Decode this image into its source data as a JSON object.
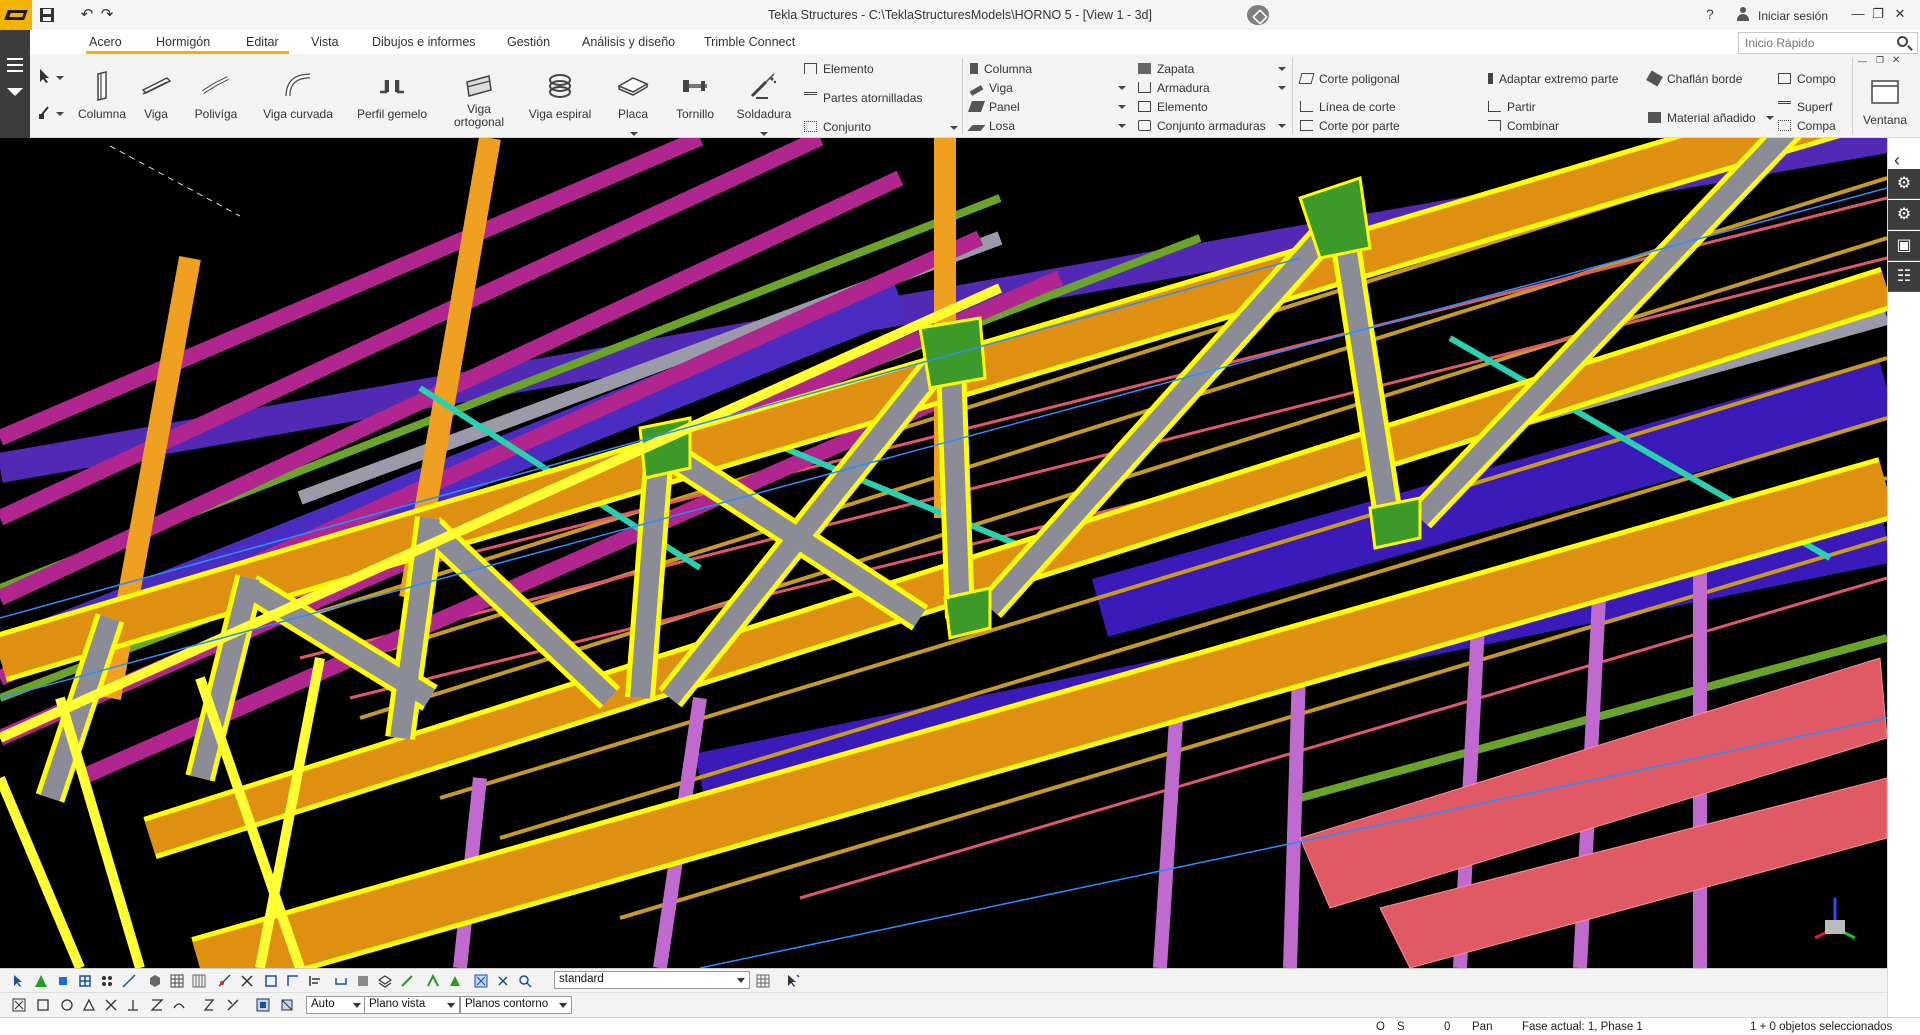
{
  "titlebar": {
    "title": "Tekla Structures - C:\\TeklaStructuresModels\\HORNO 5  - [View 1 - 3d]",
    "help": "?",
    "sign_in": "Iniciar sesión",
    "quick_access": [
      "save-icon",
      "undo-icon",
      "redo-icon"
    ]
  },
  "tabs": [
    "Acero",
    "Hormigón",
    "Editar",
    "Vista",
    "Dibujos e informes",
    "Gestión",
    "Análisis y diseño",
    "Trimble Connect"
  ],
  "active_tab": "Acero",
  "quick_search": {
    "placeholder": "Inicio Rápido"
  },
  "ribbon": {
    "steel_tools": [
      {
        "label": "Columna",
        "icon": "column-icon"
      },
      {
        "label": "Viga",
        "icon": "beam-icon"
      },
      {
        "label": "Polivíga",
        "icon": "polybeam-icon"
      },
      {
        "label": "Viga curvada",
        "icon": "curved-beam-icon"
      },
      {
        "label": "Perfil gemelo",
        "icon": "twin-profile-icon"
      },
      {
        "label_lines": [
          "Viga",
          "ortogonal"
        ],
        "icon": "orthogonal-beam-icon"
      },
      {
        "label": "Viga espiral",
        "icon": "spiral-beam-icon"
      },
      {
        "label": "Placa",
        "icon": "plate-icon"
      },
      {
        "label": "Tornillo",
        "icon": "bolt-icon"
      },
      {
        "label": "Soldadura",
        "icon": "weld-icon"
      }
    ],
    "steel_small": [
      "Elemento",
      "Partes atornilladas",
      "Conjunto"
    ],
    "concrete_col1": [
      "Columna",
      "Viga",
      "Panel",
      "Losa"
    ],
    "concrete_col2": [
      "Zapata",
      "Armadura",
      "Elemento",
      "Conjunto armaduras"
    ],
    "edit_col1": [
      "Corte poligonal",
      "Línea de corte",
      "Corte por parte"
    ],
    "edit_col2": [
      "Adaptar extremo parte",
      "Partir",
      "Combinar"
    ],
    "edit_col3": [
      "Chaflán borde",
      "Material añadido"
    ],
    "edit_col4": [
      "Compo",
      "Superf",
      "Compa"
    ],
    "window_label": "Ventana"
  },
  "toolbars": {
    "view_setting": "standard",
    "switch_auto": "Auto",
    "plane_view": "Plano vista",
    "contour_planes": "Planos contorno"
  },
  "statusbar": {
    "osnap": "O",
    "snap": "S",
    "count": "0",
    "mode": "Pan",
    "phase": "Fase actual: 1, Phase 1",
    "selection": "1 + 0 objetos seleccionados"
  },
  "colors": {
    "accent": "#f2b400",
    "ribbon_bg": "#f3f3f3",
    "dark_panel": "#3c3c3c",
    "viewport_bg": "#000000"
  }
}
